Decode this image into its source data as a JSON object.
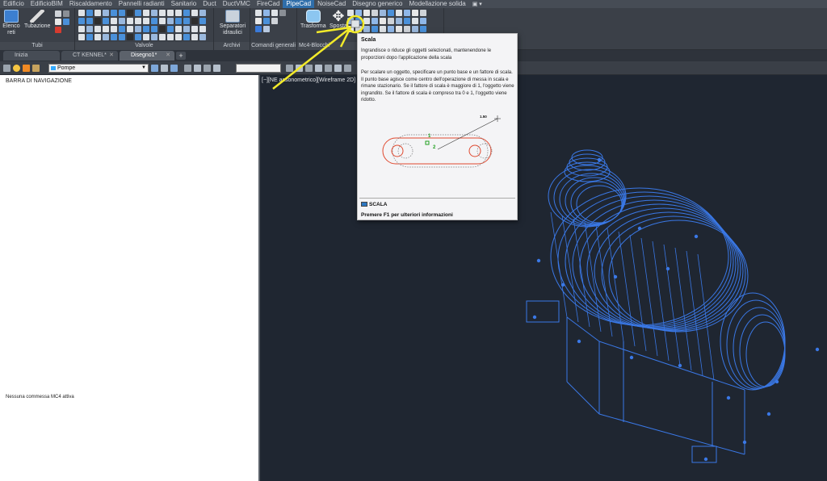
{
  "ribbon_tabs": [
    "Edificio",
    "EdificioBIM",
    "Riscaldamento",
    "Pannelli radianti",
    "Sanitario",
    "Duct",
    "DuctVMC",
    "FireCad",
    "PipeCad",
    "NoiseCad",
    "Disegno generico",
    "Modellazione solida"
  ],
  "active_ribbon_tab": "PipeCad",
  "panels": {
    "tubi": {
      "title": "Tubi",
      "elenco_reti": "Elenco reti",
      "tubazione": "Tubazione"
    },
    "valvole": {
      "title": "Valvole"
    },
    "archivi": {
      "title": "Archivi",
      "separatori": "Separatori idraulici"
    },
    "comandi_generali": {
      "title": "Comandi generali"
    },
    "mc4_blocchi": {
      "title": "Mc4-Blocchi",
      "trasforma": "Trasforma",
      "sposta": "Sposta"
    }
  },
  "file_tabs": [
    "Inizia",
    "CT KENNEL*",
    "Disegno1*"
  ],
  "active_file_tab": "Disegno1*",
  "layer_current": "Pompe",
  "nav_panel": {
    "title": "BARRA DI NAVIGAZIONE",
    "status": "Nessuna commessa MC4 attiva"
  },
  "viewport_label": "[−][NE assonometrico][Wireframe 2D]",
  "tooltip": {
    "title": "Scala",
    "description": "Ingrandisce o riduce gli oggetti selezionati, mantenendone le proporzioni dopo l'applicazione della scala",
    "detail": "Per scalare un oggetto, specificare un punto base e un fattore di scala. Il punto base agisce come centro dell'operazione di messa in scala e rimane stazionario. Se il fattore di scala è maggiore di 1, l'oggetto viene ingrandito. Se il fattore di scala è compreso tra 0 e 1, l'oggetto viene ridotto.",
    "illustration": {
      "label_1": "1",
      "label_2": "2",
      "value": "1.50"
    },
    "command": "SCALA",
    "help": "Premere F1 per ulteriori informazioni"
  },
  "colors": {
    "model_blue": "#3a78e6",
    "annotation_yellow": "#f2ea2a",
    "active_tab": "#2f6eaa",
    "viewport_bg": "#1f2631"
  }
}
